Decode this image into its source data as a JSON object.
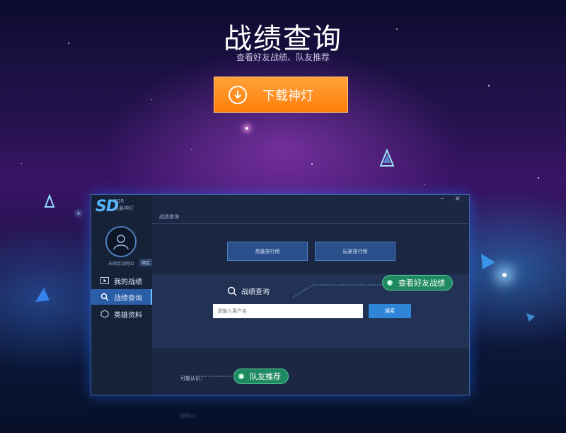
{
  "hero": {
    "title": "战绩查询",
    "subtitle": "查看好友战绩、队友推荐",
    "download_label": "下载神灯",
    "download_icon": "arrow-down-circle-icon",
    "accent": "#ff8a1a"
  },
  "app": {
    "window_controls": "– ×",
    "logo": {
      "letters": "SD",
      "for": "FOR",
      "name": "风暴神灯"
    },
    "account": {
      "unbound": "未绑定战网ID",
      "bind": "绑定"
    },
    "nav": [
      {
        "label": "我的战绩",
        "icon": "play-icon",
        "active": false
      },
      {
        "label": "战绩查询",
        "icon": "search-icon",
        "active": true
      },
      {
        "label": "英雄资料",
        "icon": "hexagon-icon",
        "active": false
      }
    ],
    "breadcrumb": "战绩查询",
    "rank_buttons": [
      "英雄排行榜",
      "玩家排行榜"
    ],
    "search": {
      "title": "战绩查询",
      "placeholder": "请输入用户名",
      "button": "搜索"
    },
    "maybe_know": "可能认识：",
    "callouts": {
      "friends": "查看好友战绩",
      "teammate": "队友推荐"
    }
  },
  "footer_faded": "战网ID"
}
